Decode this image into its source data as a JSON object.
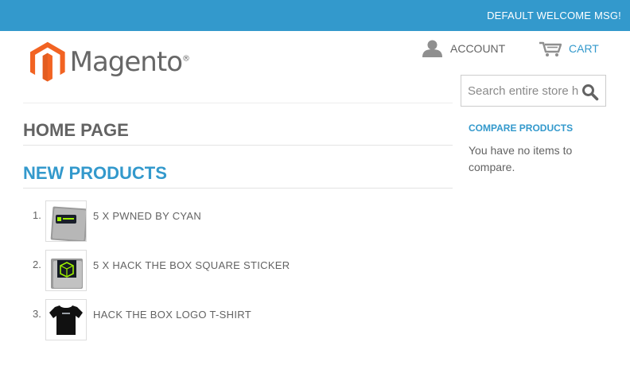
{
  "header": {
    "welcome_msg": "DEFAULT WELCOME MSG!",
    "logo_text": "Magento",
    "logo_reg": "®",
    "account_label": "ACCOUNT",
    "cart_label": "CART",
    "search_placeholder": "Search entire store here...",
    "search_value": ""
  },
  "main": {
    "page_title": "HOME PAGE",
    "section_title": "NEW PRODUCTS",
    "products": [
      {
        "num": "1.",
        "name": "5 X PWNED BY CYAN"
      },
      {
        "num": "2.",
        "name": "5 X HACK THE BOX SQUARE STICKER"
      },
      {
        "num": "3.",
        "name": "HACK THE BOX LOGO T-SHIRT"
      }
    ]
  },
  "sidebar": {
    "compare_title": "COMPARE PRODUCTS",
    "compare_empty": "You have no items to compare."
  },
  "colors": {
    "accent": "#3399cc",
    "logo_orange": "#f26322",
    "text": "#636363"
  },
  "icons": {
    "account": "user-icon",
    "cart": "cart-icon",
    "search": "magnifier-icon"
  }
}
